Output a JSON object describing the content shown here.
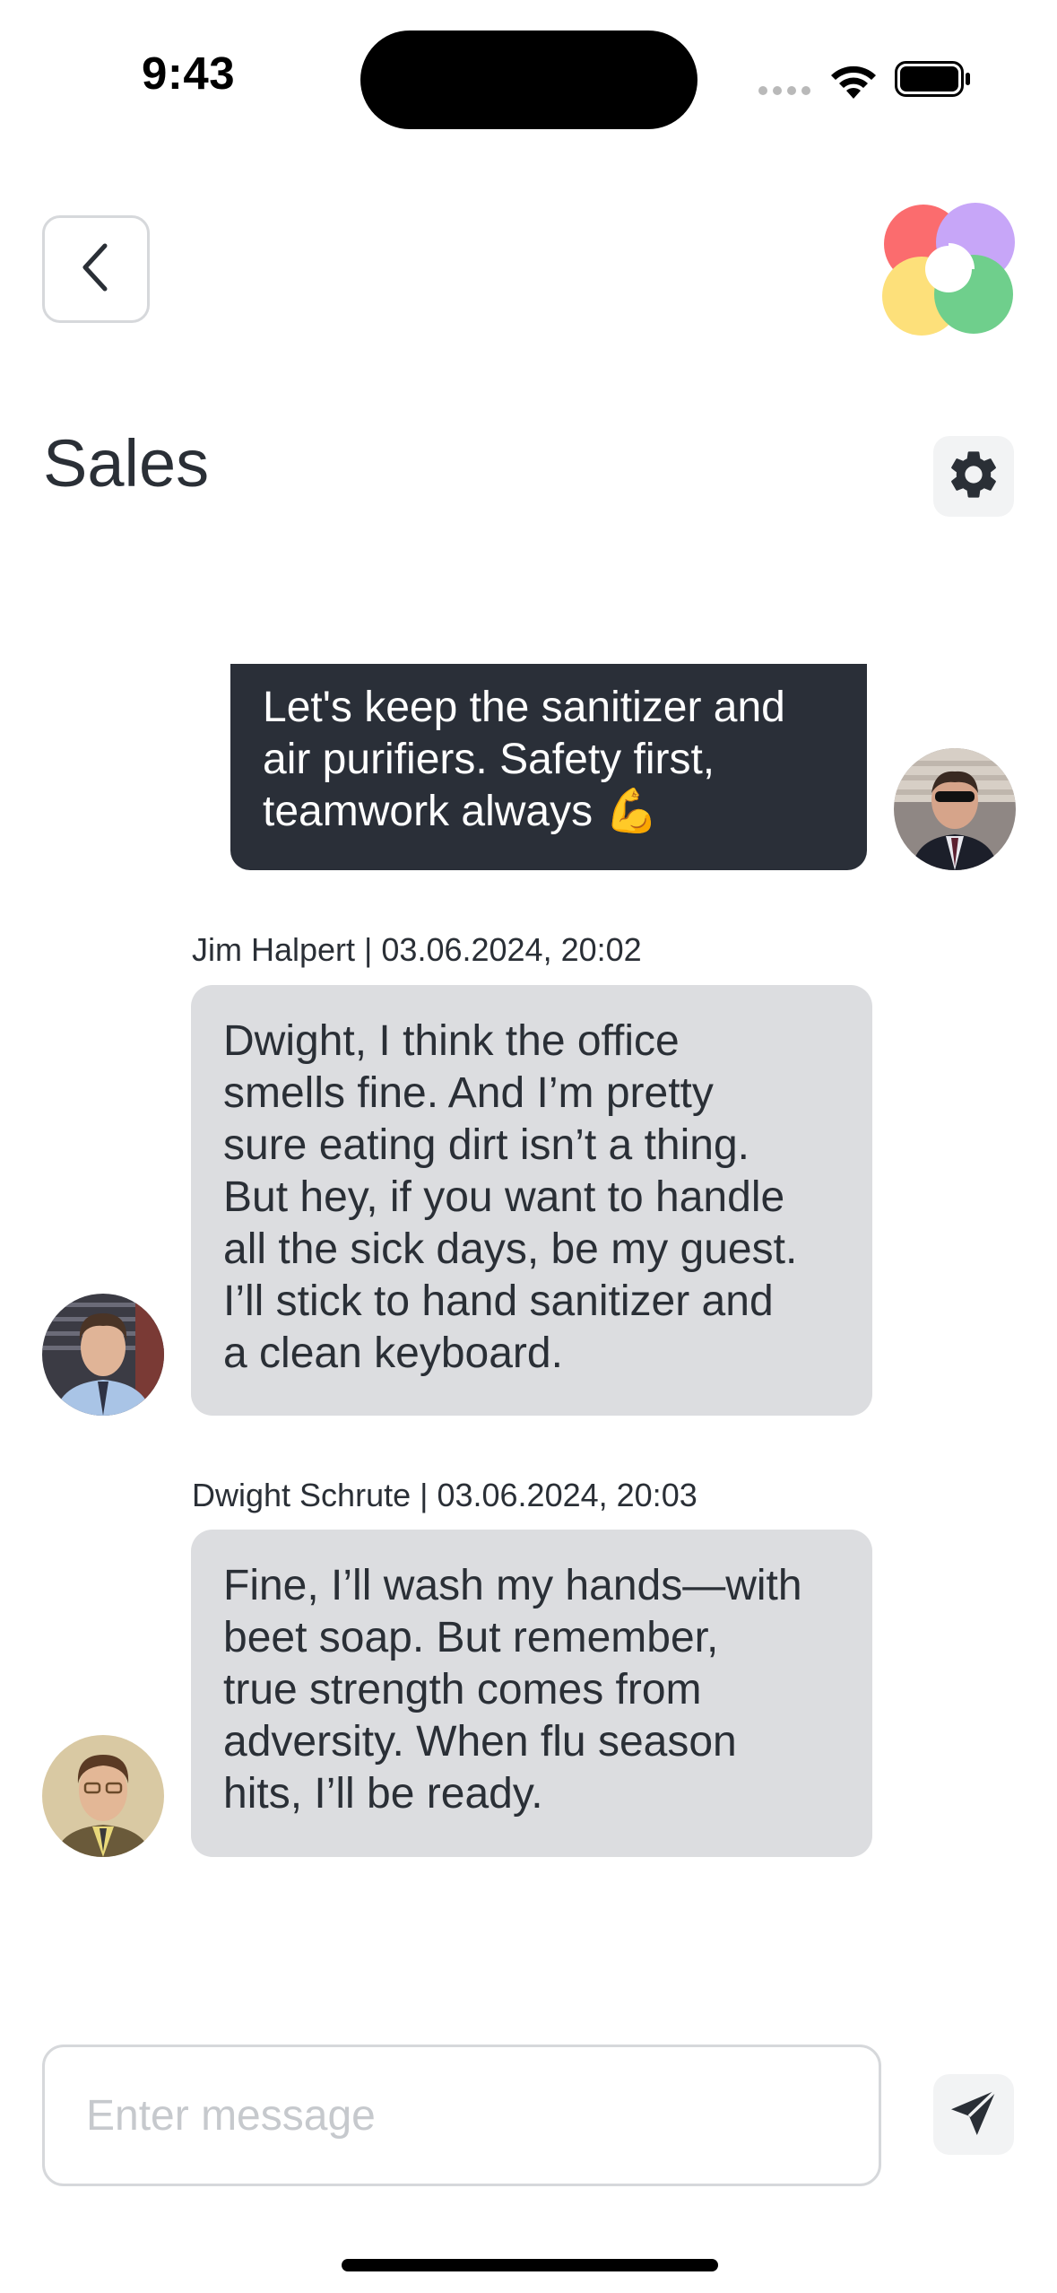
{
  "status_bar": {
    "time": "9:43"
  },
  "header": {
    "title": "Sales",
    "back_icon": "chevron-left-icon",
    "settings_icon": "gear-icon",
    "logo": "app-logo"
  },
  "messages": [
    {
      "direction": "outgoing",
      "text": "Let's keep the sanitizer and\nair purifiers. Safety first,\nteamwork always 💪",
      "avatar": "michael-scott-avatar"
    },
    {
      "direction": "incoming",
      "meta": "Jim Halpert | 03.06.2024, 20:02",
      "text": "Dwight, I think the office\nsmells fine. And I’m pretty\nsure eating dirt isn’t a thing.\nBut hey, if you want to handle\nall the sick days, be my guest.\nI’ll stick to hand sanitizer and\na clean keyboard.",
      "avatar": "jim-halpert-avatar"
    },
    {
      "direction": "incoming",
      "meta": "Dwight Schrute | 03.06.2024, 20:03",
      "text": "Fine, I’ll wash my hands—with\nbeet soap. But remember,\ntrue strength comes from\nadversity. When flu season\nhits, I’ll be ready.",
      "avatar": "dwight-schrute-avatar"
    }
  ],
  "composer": {
    "placeholder": "Enter message",
    "value": "",
    "send_icon": "send-icon"
  },
  "colors": {
    "outgoing_bubble": "#2a2f38",
    "incoming_bubble": "#dcdde0",
    "text": "#2a2f36",
    "border": "#d6d8db",
    "icon_button_bg": "#f2f3f4"
  }
}
